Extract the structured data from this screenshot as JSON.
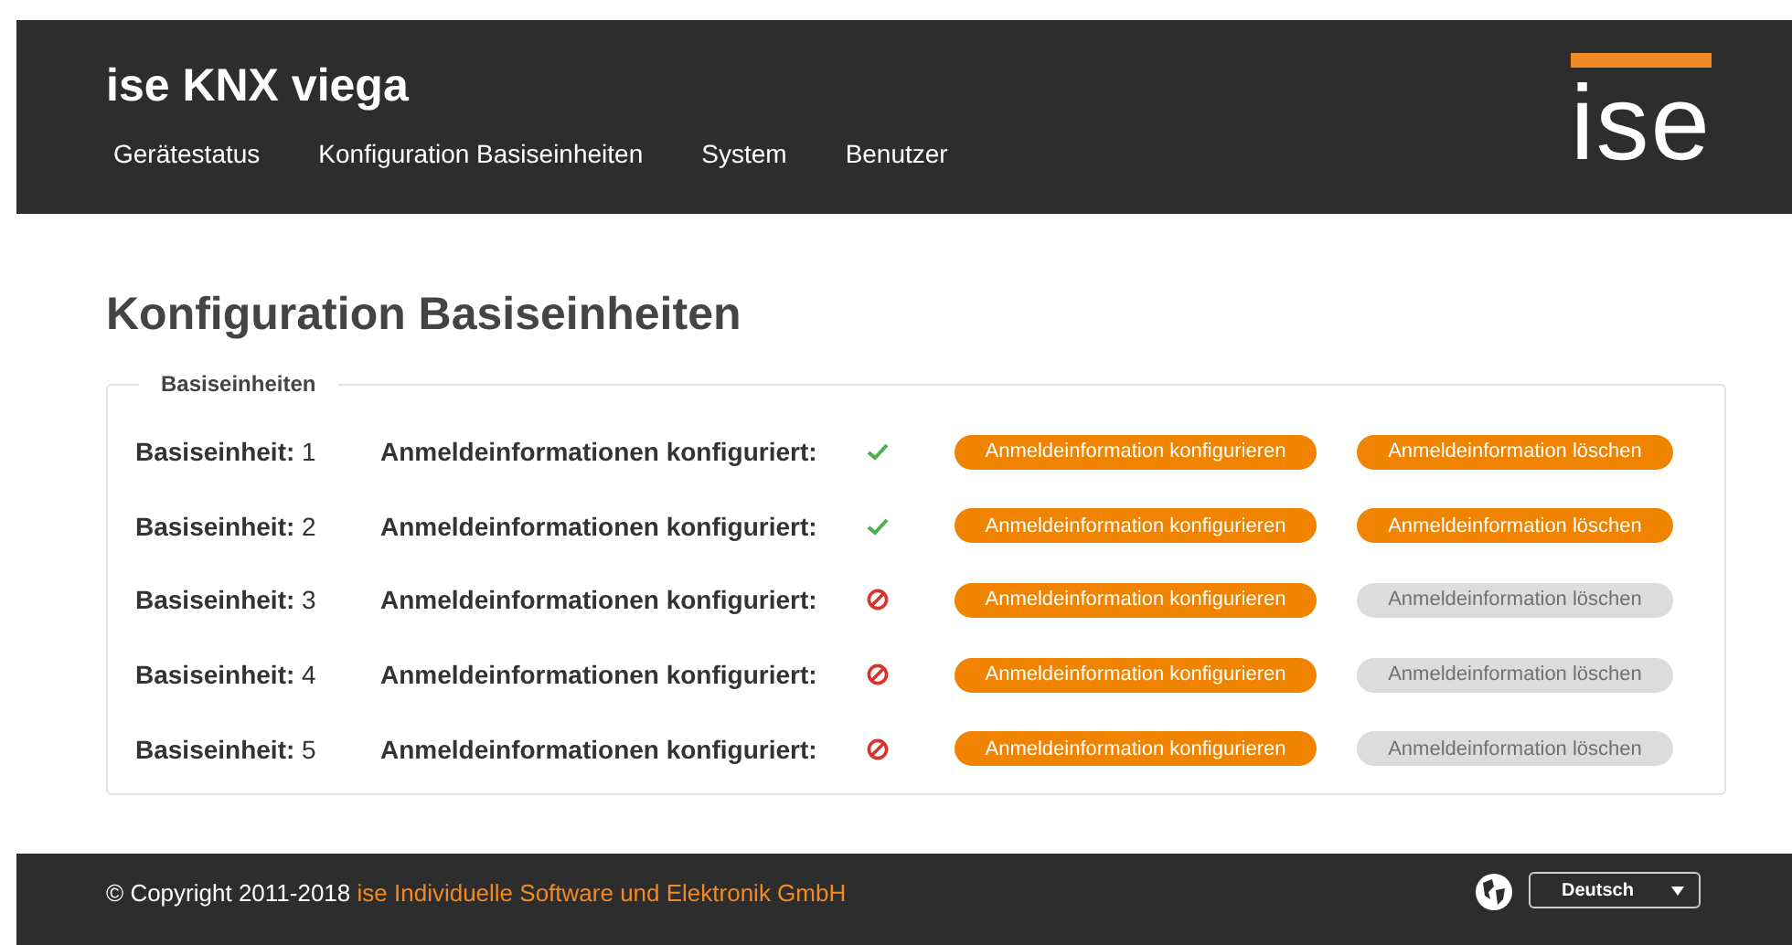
{
  "header": {
    "title": "ise KNX viega",
    "logo": "ise",
    "nav": [
      {
        "label": "Gerätestatus"
      },
      {
        "label": "Konfiguration Basiseinheiten"
      },
      {
        "label": "System"
      },
      {
        "label": "Benutzer"
      }
    ]
  },
  "page_title": "Konfiguration Basiseinheiten",
  "group": {
    "legend": "Basiseinheiten",
    "rows": [
      {
        "label": "Basiseinheit:",
        "number": "1",
        "status_label": "Anmeldeinformationen konfiguriert:",
        "configured": true,
        "configure_button": "Anmeldeinformation konfigurieren",
        "delete_button": "Anmeldeinformation löschen",
        "delete_disabled": false
      },
      {
        "label": "Basiseinheit:",
        "number": "2",
        "status_label": "Anmeldeinformationen konfiguriert:",
        "configured": true,
        "configure_button": "Anmeldeinformation konfigurieren",
        "delete_button": "Anmeldeinformation löschen",
        "delete_disabled": false
      },
      {
        "label": "Basiseinheit:",
        "number": "3",
        "status_label": "Anmeldeinformationen konfiguriert:",
        "configured": false,
        "configure_button": "Anmeldeinformation konfigurieren",
        "delete_button": "Anmeldeinformation löschen",
        "delete_disabled": true
      },
      {
        "label": "Basiseinheit:",
        "number": "4",
        "status_label": "Anmeldeinformationen konfiguriert:",
        "configured": false,
        "configure_button": "Anmeldeinformation konfigurieren",
        "delete_button": "Anmeldeinformation löschen",
        "delete_disabled": true
      },
      {
        "label": "Basiseinheit:",
        "number": "5",
        "status_label": "Anmeldeinformationen konfiguriert:",
        "configured": false,
        "configure_button": "Anmeldeinformation konfigurieren",
        "delete_button": "Anmeldeinformation löschen",
        "delete_disabled": true
      }
    ]
  },
  "footer": {
    "copyright": "© Copyright 2011-2018",
    "company_link": "ise Individuelle Software und Elektronik GmbH",
    "language": "Deutsch"
  }
}
